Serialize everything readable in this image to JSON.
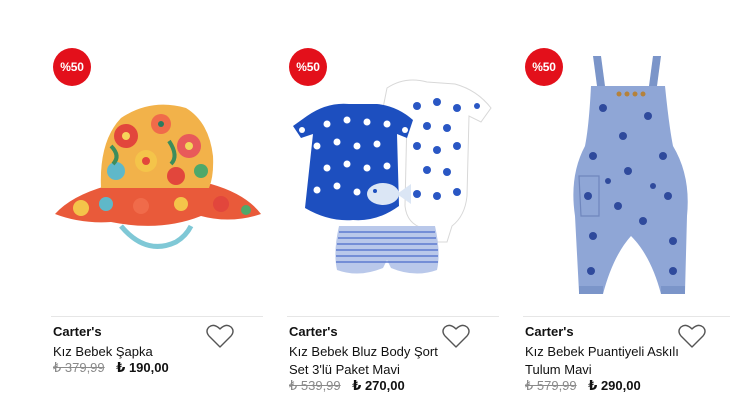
{
  "products": [
    {
      "discount": "%50",
      "brand": "Carter's",
      "name": "Kız Bebek Şapka",
      "old_price": "₺ 379,99",
      "new_price": "₺ 190,00",
      "image_icon": "floral-bucket-hat-image"
    },
    {
      "discount": "%50",
      "brand": "Carter's",
      "name": "Kız Bebek Bluz Body Şort Set 3'lü Paket Mavi",
      "old_price": "₺ 539,99",
      "new_price": "₺ 270,00",
      "image_icon": "polka-dot-set-image"
    },
    {
      "discount": "%50",
      "brand": "Carter's",
      "name": "Kız Bebek Puantiyeli Askılı Tulum Mavi",
      "old_price": "₺ 579,99",
      "new_price": "₺ 290,00",
      "image_icon": "denim-jumpsuit-image"
    }
  ],
  "colors": {
    "badge": "#e3101b",
    "old_price": "#8a8a8a",
    "text": "#111111"
  },
  "icons": {
    "favorite": "heart-outline-icon"
  }
}
